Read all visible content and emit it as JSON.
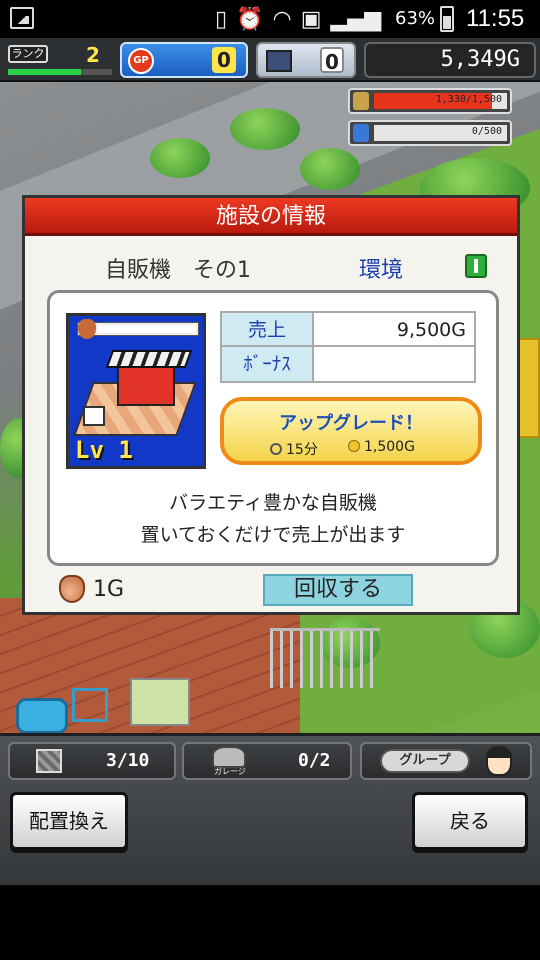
{
  "status_bar": {
    "battery_percent": "63%",
    "time": "11:55"
  },
  "hud": {
    "rank_label": "ランク",
    "rank_value": "2",
    "rank_progress": 0.7,
    "gp_label": "GP",
    "gp_value": "0",
    "pc_value": "0",
    "money": "5,349G"
  },
  "resources": {
    "gold": {
      "text": "1,330/1,500",
      "fraction": 0.887,
      "color": "#e8341c"
    },
    "water": {
      "text": "0/500",
      "fraction": 0.0,
      "color": "#3a78d8"
    }
  },
  "dialog": {
    "title": "施設の情報",
    "facility_name": "自販機　その1",
    "category": "環境",
    "level": "Lv 1",
    "stats": {
      "sales_label": "売上",
      "sales_value": "9,500G",
      "bonus_label": "ﾎﾞｰﾅｽ",
      "bonus_value": ""
    },
    "upgrade": {
      "title": "アップグレード！",
      "time": "15分",
      "cost": "1,500G"
    },
    "description_line1": "バラエティ豊かな自販機",
    "description_line2": "置いておくだけで売上が出ます",
    "income": "1G",
    "collect_label": "回収する"
  },
  "bottom": {
    "storage_value": "3/10",
    "garage_label": "ガレージ",
    "garage_value": "0/2",
    "group_label": "グループ",
    "rearrange_label": "配置換え",
    "back_label": "戻る"
  }
}
